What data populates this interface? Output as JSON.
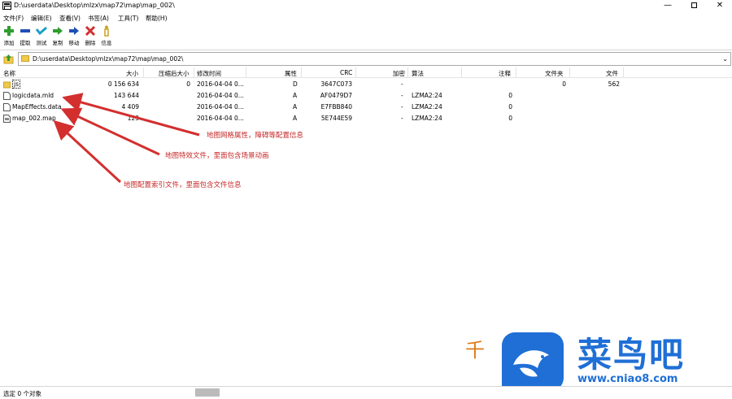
{
  "window": {
    "title": "D:\\userdata\\Desktop\\mlzx\\map72\\map\\map_002\\",
    "min": "—",
    "close": "✕"
  },
  "menu": [
    "文件(F)",
    "编辑(E)",
    "查看(V)",
    "书签(A)",
    "工具(T)",
    "帮助(H)"
  ],
  "toolbar": [
    {
      "label": "添加",
      "icon": "add-icon",
      "color": "#2e9c2e"
    },
    {
      "label": "提取",
      "icon": "extract-icon",
      "color": "#1f4fb5"
    },
    {
      "label": "测试",
      "icon": "test-icon",
      "color": "#1a9fc9"
    },
    {
      "label": "复制",
      "icon": "copy-icon",
      "color": "#2e9c2e"
    },
    {
      "label": "移动",
      "icon": "move-icon",
      "color": "#1f4fb5"
    },
    {
      "label": "删除",
      "icon": "delete-icon",
      "color": "#d32f2f"
    },
    {
      "label": "信息",
      "icon": "info-icon",
      "color": "#c9a227"
    }
  ],
  "address": {
    "path": "D:\\userdata\\Desktop\\mlzx\\map72\\map\\map_002\\"
  },
  "columns": [
    "名称",
    "大小",
    "压缩后大小",
    "修改时间",
    "属性",
    "CRC",
    "加密",
    "算法",
    "注释",
    "文件夹",
    "文件"
  ],
  "files": [
    {
      "name": "js",
      "type": "folder",
      "size": "0 156 634",
      "packed": "0",
      "modified": "2016-04-04 0...",
      "attr": "D",
      "crc": "3647C073",
      "encrypted": "-",
      "method": "",
      "comment": "",
      "folders": "0",
      "files": "562"
    },
    {
      "name": "logicdata.mld",
      "type": "file",
      "size": "143 644",
      "packed": "",
      "modified": "2016-04-04 0...",
      "attr": "A",
      "crc": "AF0479D7",
      "encrypted": "-",
      "method": "LZMA2:24",
      "comment": "0",
      "folders": "",
      "files": ""
    },
    {
      "name": "MapEffects.data",
      "type": "file",
      "size": "4 409",
      "packed": "",
      "modified": "2016-04-04 0...",
      "attr": "A",
      "crc": "E7FBB840",
      "encrypted": "-",
      "method": "LZMA2:24",
      "comment": "0",
      "folders": "",
      "files": ""
    },
    {
      "name": "map_002.map",
      "type": "file",
      "size": "129",
      "packed": "",
      "modified": "2016-04-04 0...",
      "attr": "A",
      "crc": "5E744E59",
      "encrypted": "-",
      "method": "LZMA2:24",
      "comment": "0",
      "folders": "",
      "files": ""
    }
  ],
  "annotations": [
    "地图网格属性，障碍等配置信息",
    "地图特效文件，里面包含场景动画",
    "地图配置索引文件，里面包含文件信息"
  ],
  "watermark": {
    "side_char": "千",
    "brand": "菜鸟吧",
    "url": "www.cniao8.com",
    "color": "#1f6fd6"
  },
  "status": {
    "text": "选定 0 个对象"
  }
}
